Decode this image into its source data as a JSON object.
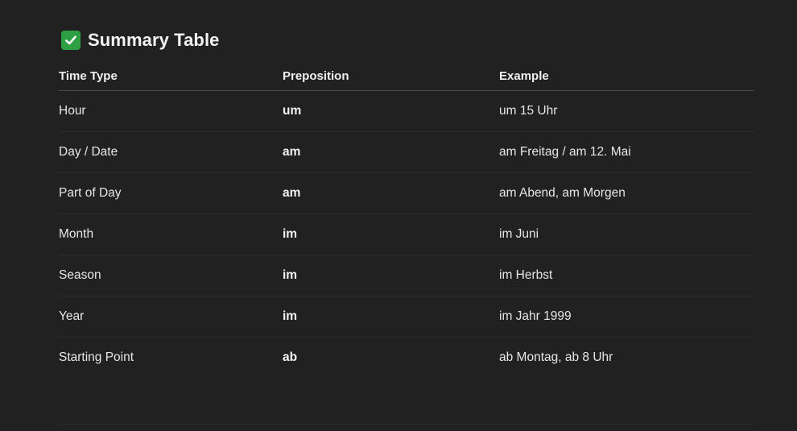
{
  "heading": {
    "icon": "check-mark-button-icon",
    "icon_color": "#2ea043",
    "title": "Summary Table"
  },
  "table": {
    "headers": [
      "Time Type",
      "Preposition",
      "Example"
    ],
    "rows": [
      {
        "time_type": "Hour",
        "preposition": "um",
        "example": "um 15 Uhr"
      },
      {
        "time_type": "Day / Date",
        "preposition": "am",
        "example": "am Freitag / am 12. Mai"
      },
      {
        "time_type": "Part of Day",
        "preposition": "am",
        "example": "am Abend, am Morgen"
      },
      {
        "time_type": "Month",
        "preposition": "im",
        "example": "im Juni"
      },
      {
        "time_type": "Season",
        "preposition": "im",
        "example": "im Herbst"
      },
      {
        "time_type": "Year",
        "preposition": "im",
        "example": "im Jahr 1999"
      },
      {
        "time_type": "Starting Point",
        "preposition": "ab",
        "example": "ab Montag, ab 8 Uhr"
      }
    ]
  },
  "colors": {
    "background": "#212121",
    "text": "#ececec"
  }
}
